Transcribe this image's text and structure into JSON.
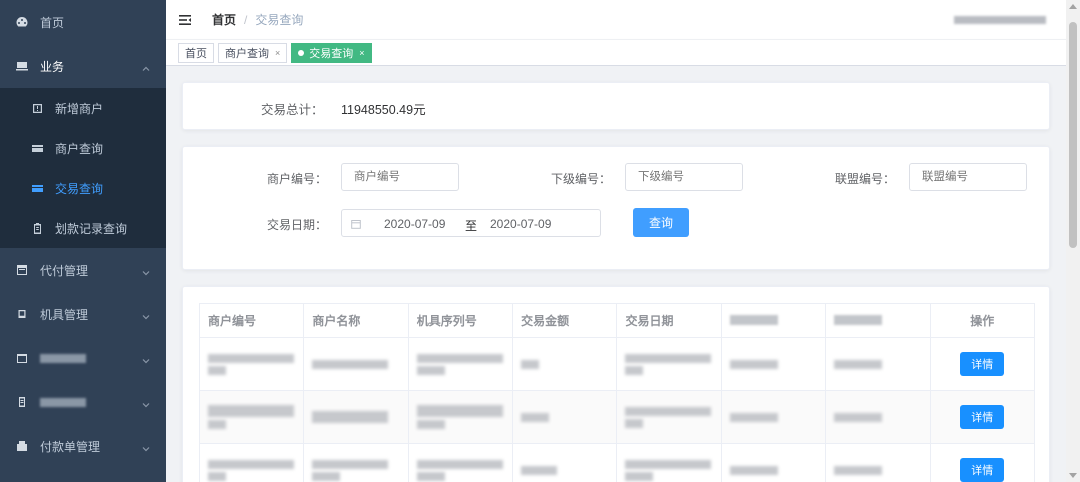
{
  "sidebar": {
    "home": "首页",
    "business": "业务",
    "business_sub": [
      {
        "label": "新增商户",
        "icon": "add-merchant-icon"
      },
      {
        "label": "商户查询",
        "icon": "merchant-card-icon"
      },
      {
        "label": "交易查询",
        "icon": "transaction-card-icon"
      },
      {
        "label": "划款记录查询",
        "icon": "transfer-record-icon"
      }
    ],
    "payment_agent": "代付管理",
    "device": "机具管理",
    "payment_order": "付款单管理"
  },
  "navbar": {
    "breadcrumb_home": "首页",
    "breadcrumb_sep": "/",
    "breadcrumb_current": "交易查询"
  },
  "tags": {
    "home": "首页",
    "merchant_query": "商户查询",
    "transaction_query": "交易查询",
    "close": "×"
  },
  "summary": {
    "label": "交易总计：",
    "value": "11948550.49元"
  },
  "filter": {
    "merchant_no_label": "商户编号：",
    "merchant_no_placeholder": "商户编号",
    "sub_no_label": "下级编号：",
    "sub_no_placeholder": "下级编号",
    "alliance_no_label": "联盟编号：",
    "alliance_no_placeholder": "联盟编号",
    "date_label": "交易日期：",
    "date_start": "2020-07-09",
    "date_to": "至",
    "date_end": "2020-07-09",
    "query_button": "查询"
  },
  "table": {
    "headers": {
      "merchant_no": "商户编号",
      "merchant_name": "商户名称",
      "device_serial": "机具序列号",
      "amount": "交易金额",
      "date": "交易日期",
      "operation": "操作"
    },
    "detail_button": "详情"
  },
  "colors": {
    "sidebar_bg": "#304156",
    "submenu_bg": "#1f2d3d",
    "accent": "#409eff",
    "active_tag": "#42b983"
  }
}
